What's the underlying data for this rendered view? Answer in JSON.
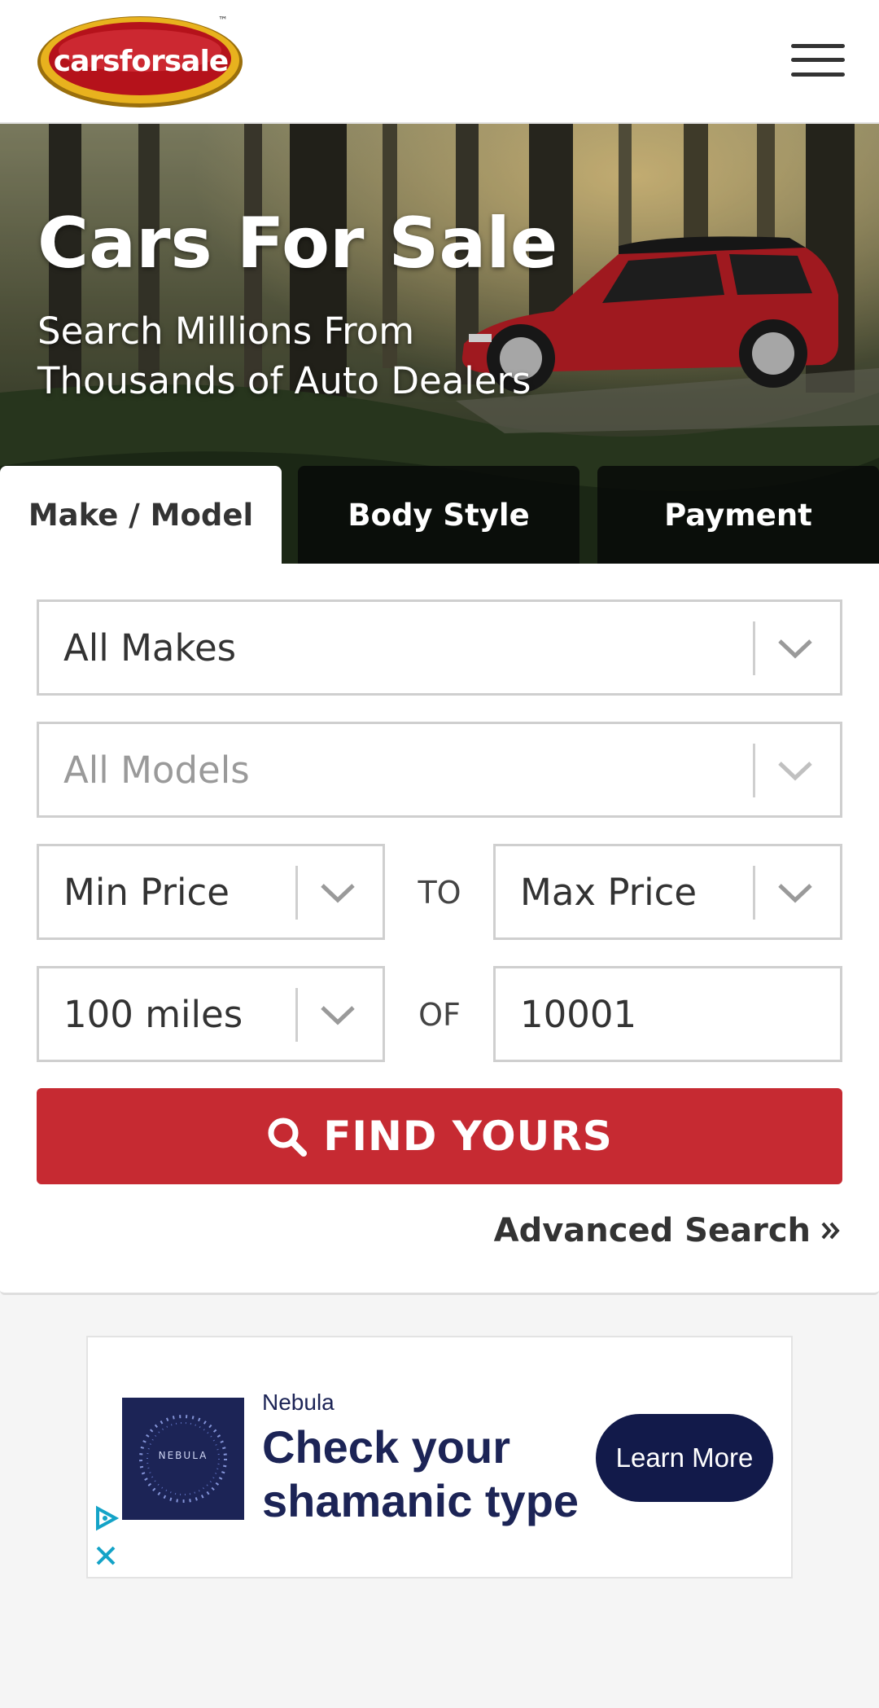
{
  "header": {
    "logo_text": "carsforsale",
    "logo_tm": "™",
    "menu_icon": "hamburger-menu-icon"
  },
  "hero": {
    "title": "Cars For Sale",
    "subtitle": "Search Millions From Thousands of Auto Dealers"
  },
  "tabs": [
    {
      "label": "Make / Model",
      "active": true
    },
    {
      "label": "Body Style",
      "active": false
    },
    {
      "label": "Payment",
      "active": false
    }
  ],
  "search": {
    "make": "All Makes",
    "model": "All Models",
    "min_price": "Min Price",
    "price_joiner": "TO",
    "max_price": "Max Price",
    "distance": "100 miles",
    "distance_joiner": "OF",
    "zip": "10001",
    "find_button": "FIND YOURS",
    "advanced_link": "Advanced Search"
  },
  "ad": {
    "brand": "Nebula",
    "image_text": "NEBULA",
    "headline": "Check your shamanic type",
    "cta": "Learn More"
  },
  "colors": {
    "brand_red": "#c62a32",
    "ad_navy": "#121a4a",
    "logo_yellow": "#e8b21e"
  }
}
